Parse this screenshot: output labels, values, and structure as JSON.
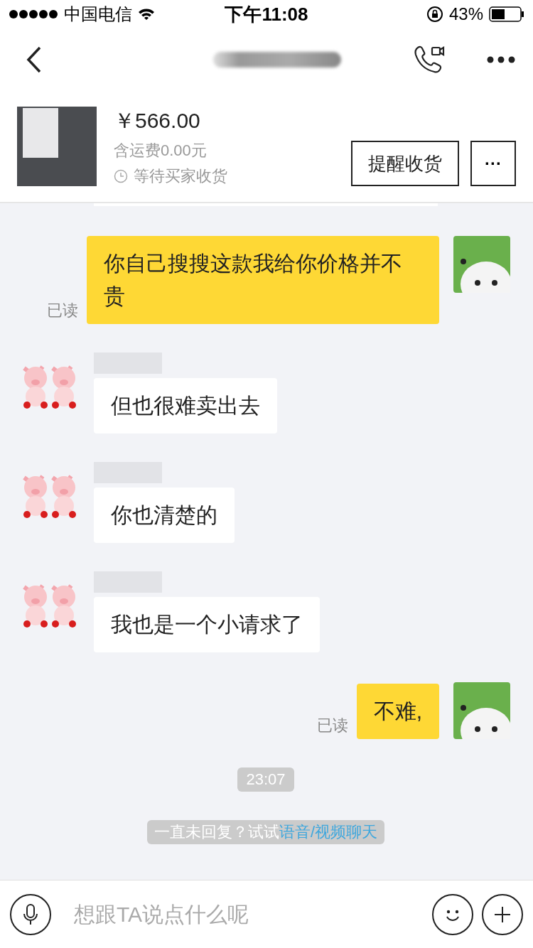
{
  "status_bar": {
    "carrier": "中国电信",
    "time": "下午11:08",
    "battery": "43%"
  },
  "product": {
    "price": "￥566.00",
    "shipping": "含运费0.00元",
    "status": "等待买家收货",
    "action": "提醒收货",
    "more": "···"
  },
  "messages": [
    {
      "kind": "outgoing",
      "text": "你自己搜搜这款我给你价格并不贵",
      "read": "已读"
    },
    {
      "kind": "incoming",
      "text": "但也很难卖出去"
    },
    {
      "kind": "incoming",
      "text": "你也清楚的"
    },
    {
      "kind": "incoming",
      "text": "我也是一个小请求了"
    },
    {
      "kind": "outgoing",
      "text": "不难,",
      "read": "已读"
    },
    {
      "kind": "time",
      "text": "23:07"
    },
    {
      "kind": "hint",
      "text": "一直未回复？试试",
      "link": "语音/视频聊天"
    }
  ],
  "input": {
    "placeholder": "想跟TA说点什么呢"
  }
}
